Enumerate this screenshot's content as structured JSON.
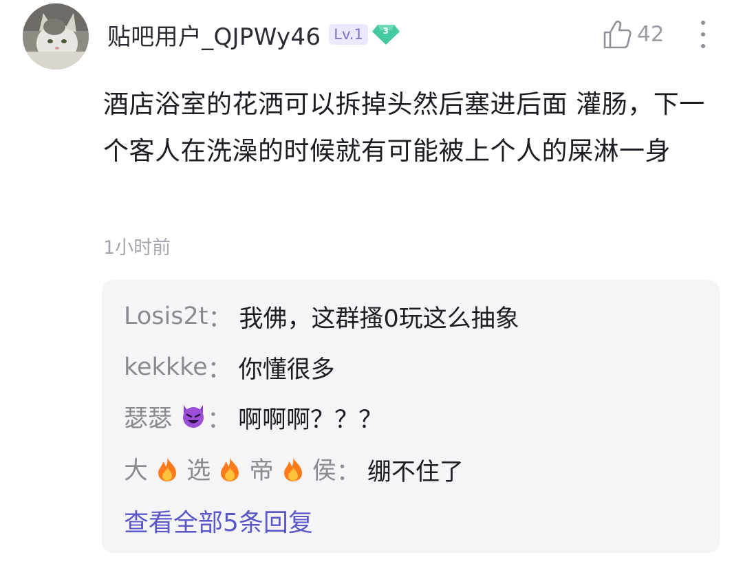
{
  "post": {
    "username": "贴吧用户_QJPWy46",
    "level": "Lv.1",
    "badge_number": "3",
    "like_count": "42",
    "content": "酒店浴室的花洒可以拆掉头然后塞进后面 灌肠，下一个客人在洗澡的时候就有可能被上个人的屎淋一身",
    "timestamp": "1小时前"
  },
  "replies": [
    {
      "name": "Losis2t",
      "text": "我佛，这群搔0玩这么抽象"
    },
    {
      "name": "kekkke",
      "text": "你懂很多"
    },
    {
      "name_part": "瑟瑟",
      "text": "啊啊啊？？？"
    },
    {
      "name_parts": [
        "大",
        "选",
        "帝",
        "侯"
      ],
      "text": "绷不住了"
    }
  ],
  "reply_separator": "：",
  "view_all_label": "查看全部5条回复",
  "colors": {
    "accent": "#5a58c8",
    "level_badge_bg": "#ebe8ff",
    "diamond": "#45c9a0",
    "reply_bg": "#f5f5f8"
  },
  "icons": {
    "like": "thumbs-up-icon",
    "more": "more-vertical-icon",
    "fire": "fire-emoji",
    "devil": "smiling-devil-emoji"
  }
}
